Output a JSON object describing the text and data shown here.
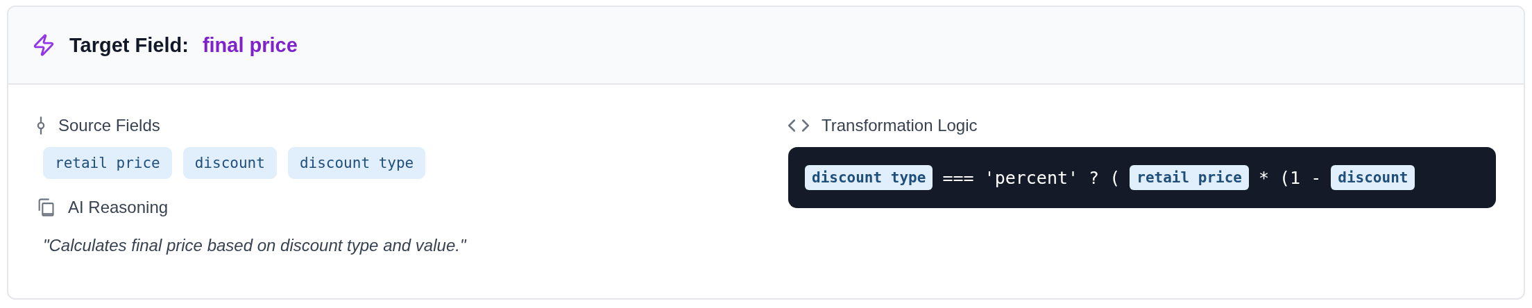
{
  "header": {
    "label": "Target Field:",
    "value": "final price"
  },
  "source_fields": {
    "title": "Source Fields",
    "fields": [
      "retail price",
      "discount",
      "discount type"
    ]
  },
  "ai_reasoning": {
    "title": "AI Reasoning",
    "text": "\"Calculates final price based on discount type and value.\""
  },
  "transformation_logic": {
    "title": "Transformation Logic",
    "tokens": [
      {
        "kind": "field",
        "text": "discount type"
      },
      {
        "kind": "text",
        "text": "=== 'percent' ? ("
      },
      {
        "kind": "field",
        "text": "retail price"
      },
      {
        "kind": "text",
        "text": "* (1 -"
      },
      {
        "kind": "field",
        "text": "discount"
      }
    ]
  }
}
